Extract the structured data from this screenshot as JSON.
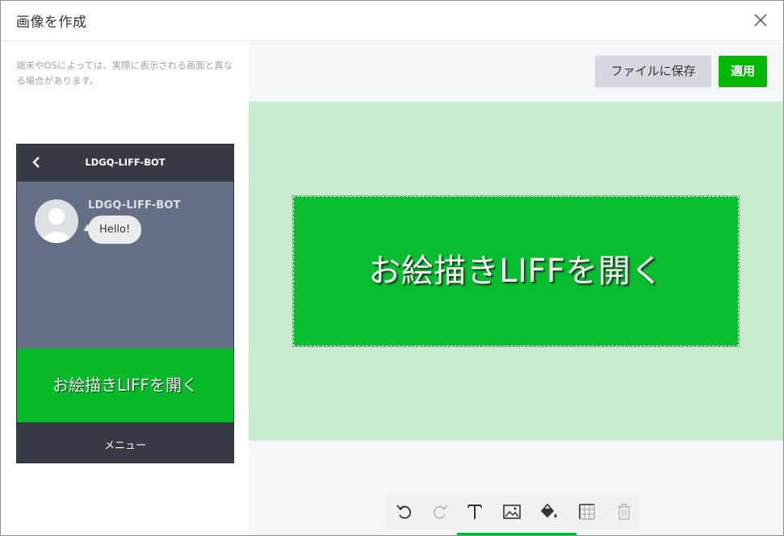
{
  "dialog": {
    "title": "画像を作成",
    "close_icon": "close-icon"
  },
  "preview": {
    "note": "端末やOSによっては、実際に表示される画面と異なる場合があります。",
    "bot_name": "LDGQ-LIFF-BOT",
    "sender_name": "LDGQ-LIFF-BOT",
    "message": "Hello!",
    "rich_menu_text": "お絵描きLIFFを開く",
    "menu_label": "メニュー"
  },
  "editor": {
    "save_label": "ファイルに保存",
    "apply_label": "適用",
    "canvas_text": "お絵描きLIFFを開く",
    "tools": [
      "undo-icon",
      "redo-icon",
      "text-icon",
      "image-icon",
      "fill-icon",
      "grid-icon",
      "trash-icon"
    ]
  },
  "colors": {
    "accent": "#00b900",
    "rich_menu": "#08be30",
    "canvas_bg": "#c8ebd0",
    "phone_dark": "#363a44",
    "chat_bg": "#666f85"
  }
}
